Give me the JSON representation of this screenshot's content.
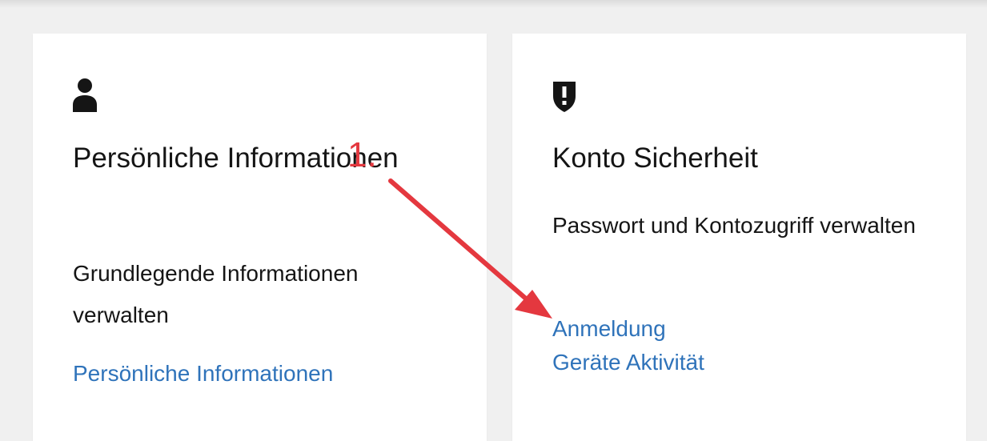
{
  "cards": [
    {
      "icon": "user-icon",
      "title": "Persönliche Informationen",
      "description": "Grundlegende Informationen verwalten",
      "links": [
        "Persönliche Informationen"
      ]
    },
    {
      "icon": "shield-exclamation-icon",
      "title": "Konto Sicherheit",
      "description": "Passwort und Kontozugriff verwalten",
      "links": [
        "Anmeldung",
        "Geräte Aktivität"
      ]
    }
  ],
  "annotation": {
    "label": "1.",
    "color": "#e4383f"
  },
  "colors": {
    "link": "#2f73ba",
    "text": "#151515",
    "background": "#f0f0f0",
    "card": "#ffffff"
  }
}
